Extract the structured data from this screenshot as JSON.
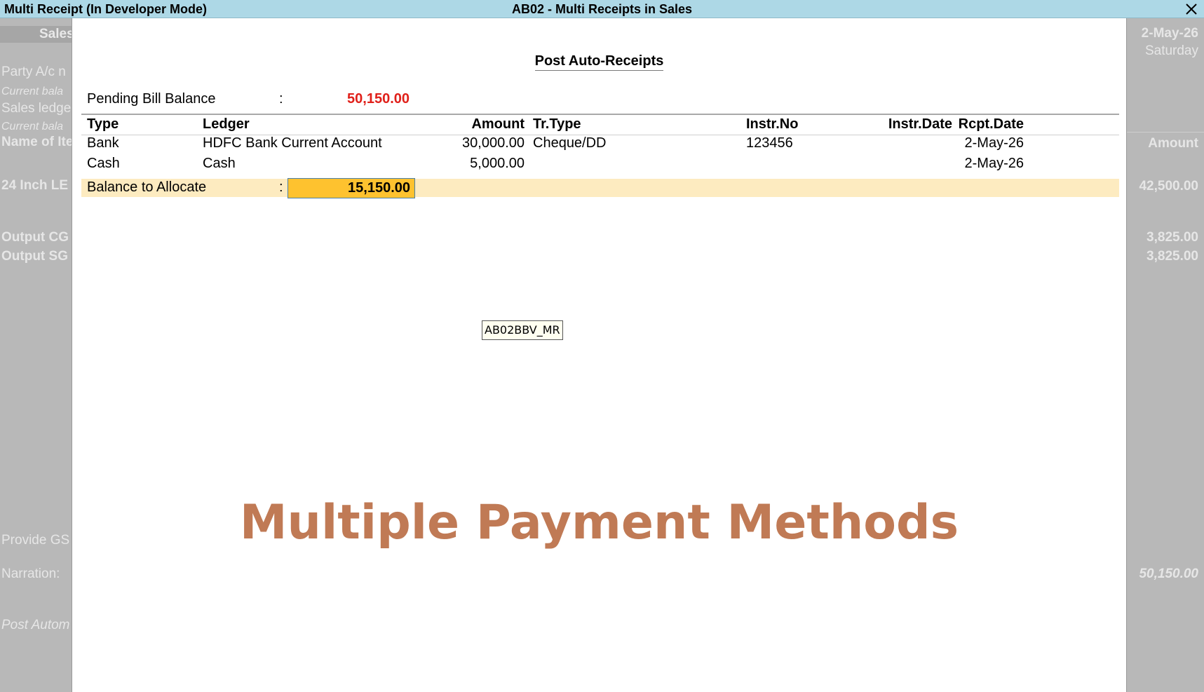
{
  "titlebar": {
    "left": "Multi Receipt (In Developer Mode)",
    "center": "AB02 - Multi Receipts in Sales",
    "close_icon": "close-icon"
  },
  "background": {
    "left": {
      "sales_header": "Sales",
      "party": "Party A/c n",
      "current_balance_1": "Current bala",
      "sales_ledger": "Sales ledge",
      "current_balance_2": "Current bala",
      "name_of_item": "Name of Ite",
      "item_1": "24 Inch LE",
      "output_cgst": "Output CG",
      "output_sgst": "Output SG",
      "provide_gst": "Provide GS",
      "narration": "Narration:",
      "post_auto": "Post Autom"
    },
    "right": {
      "date": "2-May-26",
      "day": "Saturday",
      "amount_header": "Amount",
      "item_amount": "42,500.00",
      "cgst_amount": "3,825.00",
      "sgst_amount": "3,825.00",
      "total": "50,150.00"
    }
  },
  "panel": {
    "title": "Post Auto-Receipts",
    "pending_bill_label": "Pending Bill Balance",
    "pending_bill_colon": ":",
    "pending_bill_value": "50,150.00",
    "columns": {
      "type": "Type",
      "ledger": "Ledger",
      "amount": "Amount",
      "tr_type": "Tr.Type",
      "instr_no": "Instr.No",
      "instr_date": "Instr.Date",
      "rcpt_date": "Rcpt.Date"
    },
    "rows": [
      {
        "type": "Bank",
        "ledger": "HDFC Bank Current Account",
        "amount": "30,000.00",
        "tr_type": "Cheque/DD",
        "instr_no": "123456",
        "instr_date": "",
        "rcpt_date": "2-May-26"
      },
      {
        "type": "Cash",
        "ledger": "Cash",
        "amount": "5,000.00",
        "tr_type": "",
        "instr_no": "",
        "instr_date": "",
        "rcpt_date": "2-May-26"
      }
    ],
    "balance_label": "Balance to Allocate",
    "balance_colon": ":",
    "balance_value": "15,150.00",
    "tag": "AB02BBV_MR",
    "overlay_caption": "Multiple Payment Methods"
  },
  "colors": {
    "titlebar": "#add8e6",
    "pending_value": "#e0201a",
    "highlight_row": "#fdebc0",
    "input_fill": "#fec22f",
    "overlay_text": "#c07a55"
  }
}
